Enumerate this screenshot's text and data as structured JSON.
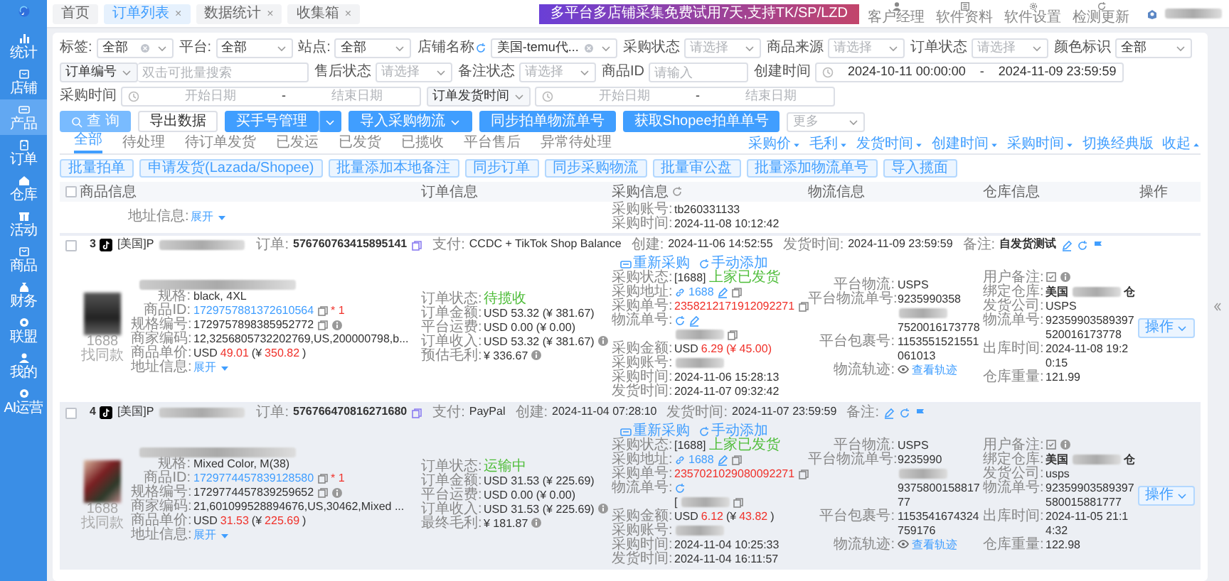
{
  "sidebar": {
    "items": [
      {
        "label": "统计",
        "selected": false
      },
      {
        "label": "店铺",
        "selected": false
      },
      {
        "label": "产品",
        "selected": true
      },
      {
        "label": "订单",
        "selected": false
      },
      {
        "label": "仓库",
        "selected": false
      },
      {
        "label": "活动",
        "selected": false
      },
      {
        "label": "商品",
        "selected": false
      },
      {
        "label": "财务",
        "selected": false
      },
      {
        "label": "联盟",
        "selected": false
      },
      {
        "label": "我的",
        "selected": false
      },
      {
        "label": "AI运营",
        "selected": false
      }
    ]
  },
  "top_tabs": [
    {
      "label": "首页",
      "selected": false
    },
    {
      "label": "订单列表",
      "close": "×",
      "selected": true
    },
    {
      "label": "数据统计",
      "close": "×",
      "selected": false
    },
    {
      "label": "收集箱",
      "close": "×",
      "selected": false
    }
  ],
  "banner": "多平台多店铺采集免费试用7天,支持TK/SP/LZD",
  "toolbar": [
    {
      "label": "客户经理"
    },
    {
      "label": "软件资料"
    },
    {
      "label": "软件设置"
    },
    {
      "label": "检测更新"
    }
  ],
  "filters": [
    [
      {
        "kind": "select",
        "label": "标签:",
        "value": "全部",
        "clearable": true
      },
      {
        "kind": "select",
        "label": "平台:",
        "value": "全部"
      },
      {
        "kind": "select",
        "label": "站点:",
        "value": "全部"
      },
      {
        "kind": "select",
        "label": "店铺名称",
        "value": "美国-temu代...",
        "clearable": true,
        "refresh": true
      },
      {
        "kind": "select",
        "label": "采购状态",
        "placeholder": "请选择"
      },
      {
        "kind": "select",
        "label": "商品来源",
        "placeholder": "请选择"
      },
      {
        "kind": "select",
        "label": "订单状态",
        "placeholder": "请选择"
      },
      {
        "kind": "select",
        "label": "颜色标识",
        "value": "全部"
      }
    ],
    [
      {
        "kind": "combo",
        "prefix": "订单编号",
        "placeholder": "双击可批量搜索"
      },
      {
        "kind": "select",
        "label": "售后状态",
        "placeholder": "请选择"
      },
      {
        "kind": "select",
        "label": "备注状态",
        "placeholder": "请选择"
      },
      {
        "kind": "input",
        "label": "商品ID",
        "placeholder": "请输入"
      },
      {
        "kind": "daterange",
        "label": "创建时间",
        "start": "2024-10-11 00:00:00",
        "separator": "-",
        "end": "2024-11-09 23:59:59"
      }
    ],
    [
      {
        "kind": "daterange",
        "label": "采购时间",
        "start_placeholder": "开始日期",
        "separator": "-",
        "end_placeholder": "结束日期"
      },
      {
        "kind": "daterange",
        "prefix": "订单发货时间",
        "start_placeholder": "开始日期",
        "separator": "-",
        "end_placeholder": "结束日期"
      }
    ]
  ],
  "actions": [
    {
      "kind": "search",
      "label": "查 询"
    },
    {
      "kind": "outline",
      "label": "导出数据"
    },
    {
      "kind": "split",
      "label": "买手号管理"
    },
    {
      "kind": "dropdown",
      "label": "导入采购物流"
    },
    {
      "kind": "primary",
      "label": "同步拍单物流单号"
    },
    {
      "kind": "primary",
      "label": "获取Shopee拍单单号"
    },
    {
      "kind": "select",
      "placeholder": "更多"
    }
  ],
  "status_tabs": [
    {
      "label": "全部",
      "selected": true
    },
    {
      "label": "待处理",
      "selected": false
    },
    {
      "label": "待订单发货",
      "selected": false
    },
    {
      "label": "已发运",
      "selected": false
    },
    {
      "label": "已发货",
      "selected": false
    },
    {
      "label": "已揽收",
      "selected": false
    },
    {
      "label": "平台售后",
      "selected": false
    },
    {
      "label": "异常待处理",
      "selected": false
    }
  ],
  "batch_buttons": [
    "批量拍单",
    "申请发货(Lazada/Shopee)",
    "批量添加本地备注",
    "同步订单",
    "同步采购物流",
    "批量审公盘",
    "批量添加物流单号",
    "导入揽面"
  ],
  "sort_links": [
    {
      "label": "采购价",
      "kind": "sort"
    },
    {
      "label": "毛利",
      "kind": "sort"
    },
    {
      "label": "发货时间",
      "kind": "sort"
    },
    {
      "label": "创建时间",
      "kind": "sort"
    },
    {
      "label": "采购时间",
      "kind": "sort"
    },
    {
      "label": "切换经典版",
      "kind": "switch"
    },
    {
      "label": "收起",
      "kind": "collapse"
    }
  ],
  "table": {
    "select_all_checked": false,
    "columns": [
      {
        "label": "商品信息"
      },
      {
        "label": "订单信息"
      },
      {
        "label": "采购信息",
        "refresh": true
      },
      {
        "label": "物流信息"
      },
      {
        "label": "仓库信息"
      },
      {
        "label": "操作"
      }
    ],
    "previous_row": {
      "product": [
        {
          "label": "地址信息:",
          "parts": [
            {
              "kind": "link",
              "text": "展开"
            },
            {
              "kind": "expand"
            }
          ]
        }
      ],
      "purchase": [
        {
          "label": "采购账号:",
          "parts": [
            {
              "kind": "text",
              "text": "tb260331133"
            }
          ]
        },
        {
          "label": "采购时间:",
          "parts": [
            {
              "kind": "text",
              "text": "2024-11-08 10:12:42"
            }
          ]
        }
      ]
    },
    "rows": [
      {
        "index": "3",
        "checked": false,
        "highlighted": false,
        "shop": "[美国]P",
        "order_label": "订单:",
        "order_no": "576760763415895141",
        "meta": [
          {
            "label": "支付:",
            "value": "CCDC + TikTok Shop Balance"
          },
          {
            "label": "创建:",
            "value": "2024-11-06 14:52:55"
          },
          {
            "label": "发货时间:",
            "value": "2024-11-09 23:59:59"
          },
          {
            "label": "备注:",
            "value": "自发货测试"
          }
        ],
        "image_caption": "1688找同款",
        "product": [
          {
            "label": "规格:",
            "parts": [
              {
                "kind": "text",
                "text": "black, 4XL"
              }
            ]
          },
          {
            "label": "商品ID:",
            "parts": [
              {
                "kind": "link",
                "text": "1729757881372610564"
              },
              {
                "kind": "copy"
              },
              {
                "kind": "accent",
                "text": "* 1"
              }
            ]
          },
          {
            "label": "规格编号:",
            "parts": [
              {
                "kind": "text",
                "text": "1729757898385952772"
              },
              {
                "kind": "copy"
              },
              {
                "kind": "info"
              }
            ]
          },
          {
            "label": "商家编码:",
            "parts": [
              {
                "kind": "text",
                "text": "12,3256805732202769,US,200000798,b..."
              }
            ]
          },
          {
            "label": "商品单价:",
            "parts": [
              {
                "kind": "text",
                "text": "USD"
              },
              {
                "kind": "accent",
                "text": "49.01"
              },
              {
                "kind": "text",
                "text": "(¥"
              },
              {
                "kind": "accent",
                "text": "350.82"
              },
              {
                "kind": "text",
                "text": ")"
              }
            ]
          },
          {
            "label": "地址信息:",
            "parts": [
              {
                "kind": "link",
                "text": "展开"
              },
              {
                "kind": "expand"
              }
            ]
          }
        ],
        "order": [
          {
            "label": "订单状态:",
            "parts": [
              {
                "kind": "status",
                "text": "待揽收"
              }
            ]
          },
          {
            "label": "订单金额:",
            "parts": [
              {
                "kind": "text",
                "text": "USD 53.32 (¥ 381.67)"
              }
            ]
          },
          {
            "label": "平台运费:",
            "parts": [
              {
                "kind": "text",
                "text": "USD 0.00 (¥ 0.00)"
              }
            ]
          },
          {
            "label": "订单收入:",
            "parts": [
              {
                "kind": "text",
                "text": "USD 53.32 (¥ 381.67)"
              },
              {
                "kind": "info"
              }
            ]
          },
          {
            "label": "预估毛利:",
            "parts": [
              {
                "kind": "text",
                "text": "¥ 336.67"
              },
              {
                "kind": "info"
              }
            ]
          }
        ],
        "purchase_actions": [
          "重新采购",
          "手动添加"
        ],
        "purchase": [
          {
            "label": "采购状态:",
            "parts": [
              {
                "kind": "text",
                "text": "[1688]"
              },
              {
                "kind": "status",
                "text": "上家已发货"
              }
            ]
          },
          {
            "label": "采购地址:",
            "parts": [
              {
                "kind": "url"
              },
              {
                "kind": "link",
                "text": "1688"
              },
              {
                "kind": "edit"
              },
              {
                "kind": "copy"
              }
            ]
          },
          {
            "label": "采购单号:",
            "parts": [
              {
                "kind": "accent",
                "text": "2358212171912092271"
              },
              {
                "kind": "copy"
              }
            ]
          },
          {
            "label": "物流单号:",
            "parts": [
              {
                "kind": "refresh"
              },
              {
                "kind": "edit"
              }
            ]
          },
          {
            "parts": [
              {
                "kind": "redacted"
              },
              {
                "kind": "copy"
              }
            ]
          },
          {
            "label": "采购金额:",
            "parts": [
              {
                "kind": "text",
                "text": "USD"
              },
              {
                "kind": "accent",
                "text": "6.29"
              },
              {
                "kind": "accent",
                "text": "(¥ 45.00)"
              }
            ]
          },
          {
            "label": "采购账号:",
            "parts": [
              {
                "kind": "redacted"
              }
            ]
          },
          {
            "label": "采购时间:",
            "parts": [
              {
                "kind": "text",
                "text": "2024-11-06 15:28:13"
              }
            ]
          },
          {
            "label": "发货时间:",
            "parts": [
              {
                "kind": "text",
                "text": "2024-11-07 09:32:42"
              }
            ]
          }
        ],
        "logistics": [
          {
            "label": "平台物流:",
            "parts": [
              {
                "kind": "text",
                "text": "USPS"
              }
            ]
          },
          {
            "label": "平台物流单号:",
            "parts": [
              {
                "kind": "text",
                "text": "9235990358"
              },
              {
                "kind": "redacted"
              },
              {
                "kind": "text",
                "text": "7520016173778"
              }
            ]
          },
          {
            "label": "平台包裹号:",
            "parts": [
              {
                "kind": "text",
                "text": "1153551521551061013"
              }
            ]
          },
          {
            "label": "物流轨迹:",
            "parts": [
              {
                "kind": "track"
              },
              {
                "kind": "link",
                "text": "查看轨迹"
              }
            ]
          }
        ],
        "warehouse": [
          {
            "label": "用户备注:",
            "parts": [
              {
                "kind": "note"
              },
              {
                "kind": "info"
              }
            ]
          },
          {
            "label": "绑定仓库:",
            "parts": [
              {
                "kind": "strong",
                "text": "美国"
              },
              {
                "kind": "redacted"
              },
              {
                "kind": "strong",
                "text": "仓"
              }
            ]
          },
          {
            "label": "发货公司:",
            "parts": [
              {
                "kind": "text",
                "text": "USPS"
              }
            ]
          },
          {
            "label": "物流单号:",
            "parts": [
              {
                "kind": "text",
                "text": "92359903589397520016173778"
              }
            ]
          },
          {
            "label": "出库时间:",
            "parts": [
              {
                "kind": "text",
                "text": "2024-11-08 19:20:15"
              }
            ]
          },
          {
            "label": "仓库重量:",
            "parts": [
              {
                "kind": "text",
                "text": "121.99"
              }
            ]
          }
        ],
        "operation": "操作"
      },
      {
        "index": "4",
        "checked": false,
        "highlighted": true,
        "shop": "[美国]P",
        "order_label": "订单:",
        "order_no": "576766470816271680",
        "meta": [
          {
            "label": "支付:",
            "value": "PayPal"
          },
          {
            "label": "创建:",
            "value": "2024-11-04 07:28:10"
          },
          {
            "label": "发货时间:",
            "value": "2024-11-07 23:59:59"
          },
          {
            "label": "备注:"
          }
        ],
        "image_caption": "1688找同款",
        "product": [
          {
            "label": "规格:",
            "parts": [
              {
                "kind": "text",
                "text": "Mixed Color, M(38)"
              }
            ]
          },
          {
            "label": "商品ID:",
            "parts": [
              {
                "kind": "link",
                "text": "1729774457839128580"
              },
              {
                "kind": "copy"
              },
              {
                "kind": "accent",
                "text": "* 1"
              }
            ]
          },
          {
            "label": "规格编号:",
            "parts": [
              {
                "kind": "text",
                "text": "1729774457839259652"
              },
              {
                "kind": "copy"
              },
              {
                "kind": "info"
              }
            ]
          },
          {
            "label": "商家编码:",
            "parts": [
              {
                "kind": "text",
                "text": "21,601099528894676,US,30462,Mixed ..."
              }
            ]
          },
          {
            "label": "商品单价:",
            "parts": [
              {
                "kind": "text",
                "text": "USD"
              },
              {
                "kind": "accent",
                "text": "31.53"
              },
              {
                "kind": "text",
                "text": "(¥"
              },
              {
                "kind": "accent",
                "text": "225.69"
              },
              {
                "kind": "text",
                "text": ")"
              }
            ]
          },
          {
            "label": "地址信息:",
            "parts": [
              {
                "kind": "link",
                "text": "展开"
              },
              {
                "kind": "expand"
              }
            ]
          }
        ],
        "order": [
          {
            "label": "订单状态:",
            "parts": [
              {
                "kind": "status",
                "text": "运输中"
              }
            ]
          },
          {
            "label": "订单金额:",
            "parts": [
              {
                "kind": "text",
                "text": "USD 31.53 (¥ 225.69)"
              }
            ]
          },
          {
            "label": "平台运费:",
            "parts": [
              {
                "kind": "text",
                "text": "USD 0.00 (¥ 0.00)"
              }
            ]
          },
          {
            "label": "订单收入:",
            "parts": [
              {
                "kind": "text",
                "text": "USD 31.53 (¥ 225.69)"
              },
              {
                "kind": "info"
              }
            ]
          },
          {
            "label": "最终毛利:",
            "parts": [
              {
                "kind": "text",
                "text": "¥ 181.87"
              },
              {
                "kind": "info"
              }
            ]
          }
        ],
        "purchase_actions": [
          "重新采购",
          "手动添加"
        ],
        "purchase": [
          {
            "label": "采购状态:",
            "parts": [
              {
                "kind": "text",
                "text": "[1688]"
              },
              {
                "kind": "status",
                "text": "上家已发货"
              }
            ]
          },
          {
            "label": "采购地址:",
            "parts": [
              {
                "kind": "url"
              },
              {
                "kind": "link",
                "text": "1688"
              },
              {
                "kind": "edit"
              },
              {
                "kind": "copy"
              }
            ]
          },
          {
            "label": "采购单号:",
            "parts": [
              {
                "kind": "accent",
                "text": "2357021029080092271"
              },
              {
                "kind": "copy"
              }
            ]
          },
          {
            "label": "物流单号:",
            "parts": [
              {
                "kind": "refresh"
              }
            ]
          },
          {
            "parts": [
              {
                "kind": "text",
                "text": "["
              },
              {
                "kind": "redacted"
              },
              {
                "kind": "copy"
              }
            ]
          },
          {
            "label": "采购金额:",
            "parts": [
              {
                "kind": "text",
                "text": "USD"
              },
              {
                "kind": "accent",
                "text": "6.12"
              },
              {
                "kind": "text",
                "text": "(¥"
              },
              {
                "kind": "accent",
                "text": "43.82"
              },
              {
                "kind": "text",
                "text": ")"
              }
            ]
          },
          {
            "label": "采购账号:",
            "parts": [
              {
                "kind": "redacted"
              }
            ]
          },
          {
            "label": "采购时间:",
            "parts": [
              {
                "kind": "text",
                "text": "2024-11-04 10:25:33"
              }
            ]
          },
          {
            "label": "发货时间:",
            "parts": [
              {
                "kind": "text",
                "text": "2024-11-04 16:11:57"
              }
            ]
          }
        ],
        "logistics": [
          {
            "label": "平台物流:",
            "parts": [
              {
                "kind": "text",
                "text": "USPS"
              }
            ]
          },
          {
            "label": "平台物流单号:",
            "parts": [
              {
                "kind": "text",
                "text": "9235990"
              },
              {
                "kind": "redacted"
              },
              {
                "kind": "text",
                "text": "937580015881777"
              }
            ]
          },
          {
            "label": "平台包裹号:",
            "parts": [
              {
                "kind": "text",
                "text": "1153541674324759176"
              }
            ]
          },
          {
            "label": "物流轨迹:",
            "parts": [
              {
                "kind": "track"
              },
              {
                "kind": "link",
                "text": "查看轨迹"
              }
            ]
          }
        ],
        "warehouse": [
          {
            "label": "用户备注:",
            "parts": [
              {
                "kind": "note"
              },
              {
                "kind": "info"
              }
            ]
          },
          {
            "label": "绑定仓库:",
            "parts": [
              {
                "kind": "strong",
                "text": "美国"
              },
              {
                "kind": "redacted"
              },
              {
                "kind": "strong",
                "text": "仓"
              }
            ]
          },
          {
            "label": "发货公司:",
            "parts": [
              {
                "kind": "text",
                "text": "usps"
              }
            ]
          },
          {
            "label": "物流单号:",
            "parts": [
              {
                "kind": "text",
                "text": "92359903589397580015881777"
              }
            ]
          },
          {
            "label": "出库时间:",
            "parts": [
              {
                "kind": "text",
                "text": "2024-11-05 21:14:32"
              }
            ]
          },
          {
            "label": "仓库重量:",
            "parts": [
              {
                "kind": "text",
                "text": "122.98"
              }
            ]
          }
        ],
        "operation": "操作"
      }
    ]
  }
}
